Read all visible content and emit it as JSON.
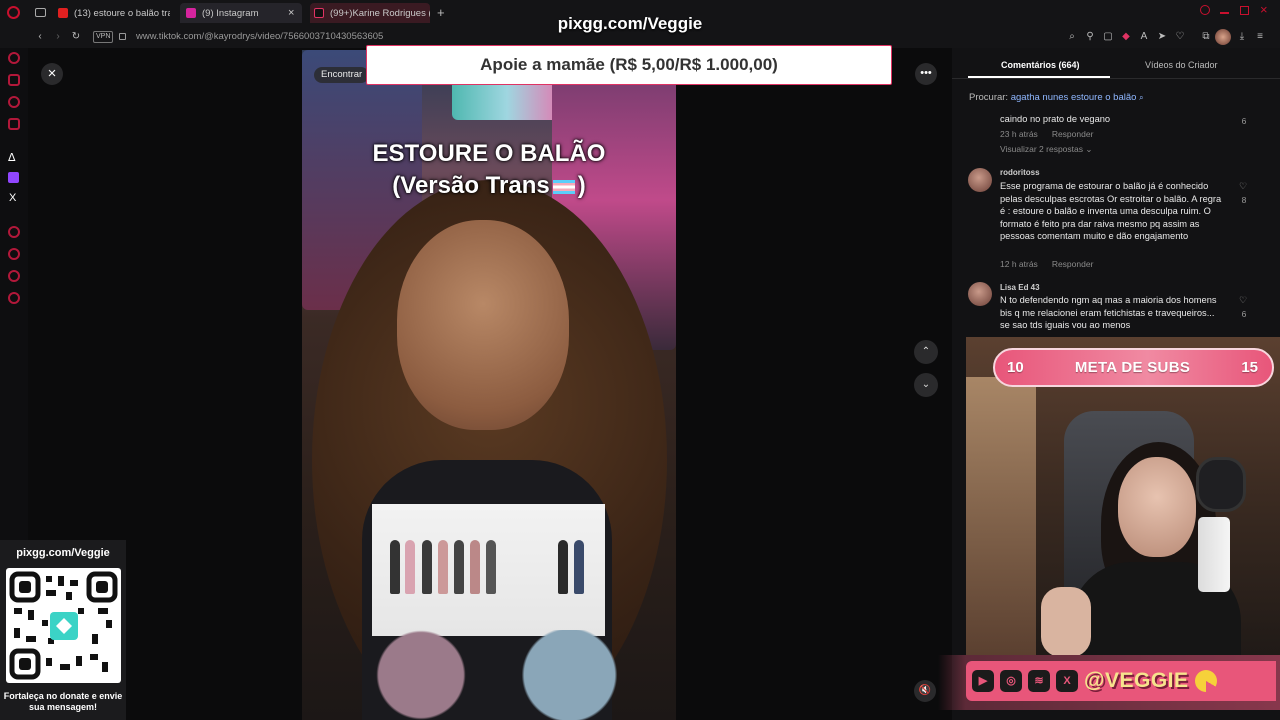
{
  "browser": {
    "tabs": [
      {
        "label": "(13) estoure o balão trans",
        "favicon": "youtube-icon",
        "color": "#e02020"
      },
      {
        "label": "(9) Instagram",
        "favicon": "instagram-icon",
        "color": "#d6249f"
      },
      {
        "label": "(99+)Karine Rodrigues (@",
        "favicon": "tiktok-icon",
        "color": "#111111"
      }
    ],
    "new_tab_symbol": "+",
    "vpn_label": "VPN",
    "url": "www.tiktok.com/@kayrodrys/video/7566003710430563605"
  },
  "overlay": {
    "stream_url": "pixgg.com/Veggie",
    "donate_banner": "Apoie a mamãe (R$ 5,00/R$ 1.000,00)"
  },
  "video": {
    "title_line1": "ESTOURE O BALÃO",
    "title_line2": "(Versão Trans",
    "title_line2_end": ")",
    "find_chip": "Encontrar",
    "close_symbol": "×",
    "more_symbol": "•••",
    "prev_symbol": "⌃",
    "next_symbol": "⌄",
    "mute_symbol": "🔇"
  },
  "panel": {
    "tab_comments": "Comentários (664)",
    "tab_creator": "Vídeos do Criador",
    "search_prefix": "Procurar:",
    "search_query": "agatha nunes estoure o balão",
    "comments": [
      {
        "user": "",
        "text": "caindo no prato de vegano",
        "time": "23 h atrás",
        "reply": "Responder",
        "likes": "6",
        "view_replies": "Visualizar 2 respostas ⌄"
      },
      {
        "user": "rodoritoss",
        "text": "Esse programa de estourar o balão já é conhecido pelas desculpas escrotas Or estroitar o balão. A regra é : estoure o balão e inventa uma desculpa ruim. O formato é feito pra dar raiva mesmo pq assim as pessoas comentam muito e dão engajamento",
        "time": "12 h atrás",
        "reply": "Responder",
        "likes": "8"
      },
      {
        "user": "Lisa Ed 43",
        "text": "N to defendendo ngm aq mas a maioria dos homens bis q me relacionei eram fetichistas e travequeiros... se sao tds iguais vou ao menos",
        "time": "",
        "reply": "",
        "likes": "6"
      }
    ]
  },
  "goal": {
    "start": "10",
    "label": "META DE SUBS",
    "end": "15"
  },
  "social": {
    "handle": "@VEGGIE",
    "icons": [
      "youtube-icon",
      "instagram-icon",
      "spotify-icon",
      "x-icon"
    ]
  },
  "qr_card": {
    "title": "pixgg.com/Veggie",
    "caption": "Fortaleça no donate e envie sua mensagem!"
  },
  "colors": {
    "accent": "#e8567a",
    "banner_border": "#e03363",
    "handle": "#f6e38d"
  }
}
